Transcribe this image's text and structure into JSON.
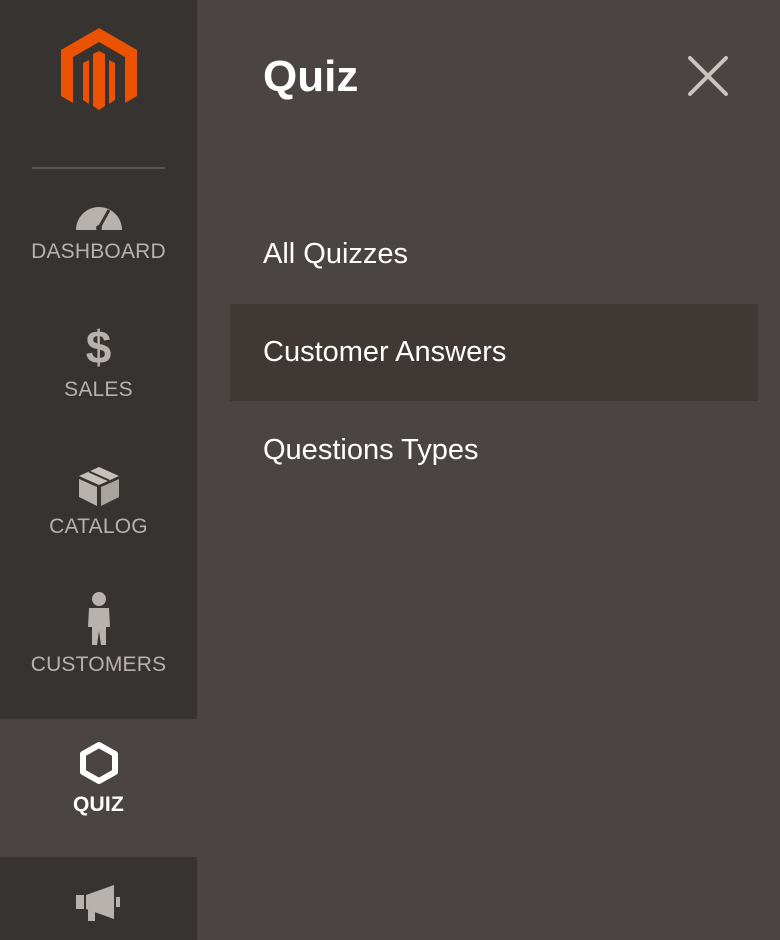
{
  "colors": {
    "sidebar_bg": "#373330",
    "panel_bg": "#4a4542",
    "active_item_bg": "#3f3835",
    "logo_orange": "#eb5202",
    "text_white": "#ffffff",
    "nav_label_gray": "#b8b2ae"
  },
  "sidebar": {
    "items": [
      {
        "label": "DASHBOARD",
        "icon": "dashboard-gauge-icon",
        "active": false
      },
      {
        "label": "SALES",
        "icon": "dollar-icon",
        "active": false
      },
      {
        "label": "CATALOG",
        "icon": "box-icon",
        "active": false
      },
      {
        "label": "CUSTOMERS",
        "icon": "person-icon",
        "active": false
      },
      {
        "label": "QUIZ",
        "icon": "hexagon-icon",
        "active": true
      },
      {
        "label": "",
        "icon": "megaphone-icon",
        "active": false
      }
    ]
  },
  "panel": {
    "title": "Quiz",
    "close_icon": "close-icon",
    "items": [
      {
        "label": "All Quizzes",
        "active": false
      },
      {
        "label": "Customer Answers",
        "active": true
      },
      {
        "label": "Questions Types",
        "active": false
      }
    ]
  }
}
